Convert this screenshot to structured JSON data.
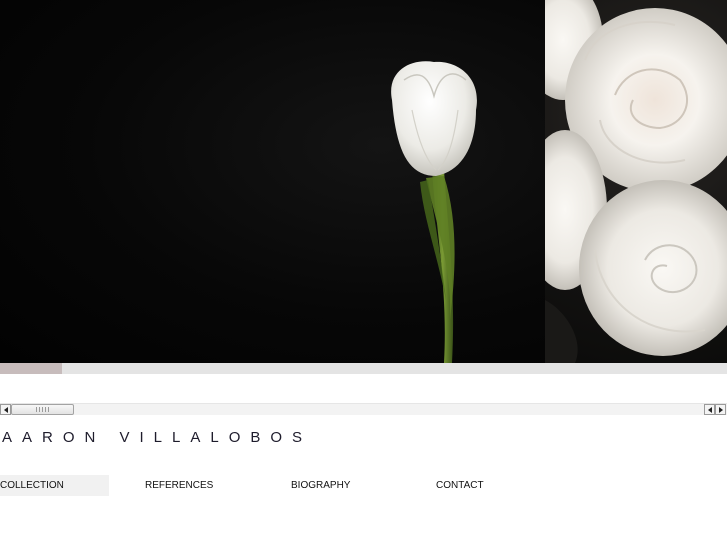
{
  "site": {
    "logo_text": "AARON VILLALOBOS"
  },
  "gallery": {
    "photos": [
      {
        "name": "white-tulip",
        "background": "#050505"
      },
      {
        "name": "white-roses",
        "background": "#141312"
      }
    ],
    "progress": 0.085
  },
  "nav": {
    "items": [
      {
        "label": "COLLECTION",
        "active": true
      },
      {
        "label": "REFERENCES",
        "active": false
      },
      {
        "label": "BIOGRAPHY",
        "active": false
      },
      {
        "label": "CONTACT",
        "active": false
      }
    ]
  },
  "colors": {
    "logo": "#1e1c2c",
    "progress_fill": "#c7bcbc",
    "progress_track": "#e4e4e4",
    "active_nav": "#f1f1f1"
  },
  "icons": {
    "scroll_left": "triangle-left-icon",
    "scroll_right": "triangle-right-icon"
  }
}
